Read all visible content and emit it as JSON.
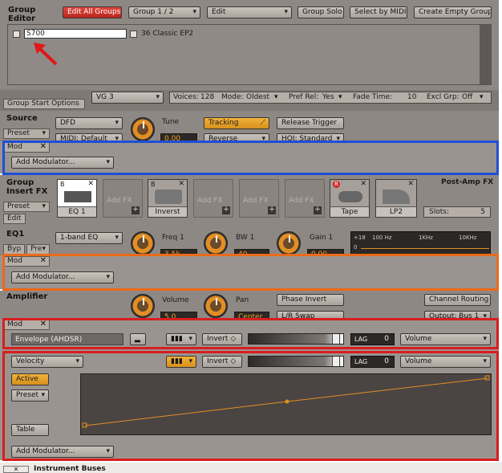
{
  "group_editor": {
    "title_line1": "Group",
    "title_line2": "Editor",
    "buttons": {
      "edit_all_groups": "Edit All Groups",
      "group_select": "Group 1 / 2",
      "edit": "Edit",
      "group_solo": "Group Solo",
      "select_by_midi": "Select by MIDI",
      "create_empty_group": "Create Empty Group"
    },
    "groups": [
      {
        "name": "S700",
        "checked": false
      },
      {
        "name": "36 Classic EP2",
        "checked": false
      }
    ]
  },
  "group_start_options": {
    "tab_label": "Group Start Options",
    "vg_value": "VG 3",
    "voices_label": "Voices:",
    "voices_value": "128",
    "mode_label": "Mode:",
    "mode_value": "Oldest",
    "pref_rel_label": "Pref Rel:",
    "pref_rel_value": "Yes",
    "fade_time_label": "Fade Time:",
    "fade_time_value": "10",
    "excl_grp_label": "Excl Grp:",
    "excl_grp_value": "Off"
  },
  "source": {
    "title": "Source",
    "preset_label": "Preset",
    "mode_value": "DFD",
    "midi_default": "MIDI: Default",
    "tune_label": "Tune",
    "tune_value": "0.00",
    "tracking_label": "Tracking",
    "reverse_label": "Reverse",
    "release_trigger_label": "Release Trigger",
    "hq_label": "HQI: Standard"
  },
  "mod_source": {
    "tab_label": "Mod",
    "add_modulator": "Add Modulator..."
  },
  "insert_fx": {
    "title_line1": "Group",
    "title_line2": "Insert FX",
    "preset_label": "Preset",
    "edit_label": "Edit",
    "post_amp_label": "Post-Amp FX",
    "slots_label": "Slots:",
    "slots_value": "5",
    "slots": [
      {
        "name": "EQ 1",
        "state": "filled"
      },
      {
        "name": "Add FX",
        "state": "empty"
      },
      {
        "name": "Inverst",
        "state": "filled"
      },
      {
        "name": "Add FX",
        "state": "empty"
      },
      {
        "name": "Add FX",
        "state": "empty"
      },
      {
        "name": "Add FX",
        "state": "empty"
      }
    ],
    "post_slots": [
      {
        "name": "Tape",
        "state": "filled"
      },
      {
        "name": "LP2",
        "state": "filled"
      }
    ]
  },
  "eq1": {
    "title": "EQ1",
    "byp_label": "Byp",
    "pre_label": "Pre",
    "type_value": "1-band EQ",
    "freq_label": "Freq 1",
    "freq_value": "3.5k",
    "bw_label": "BW 1",
    "bw_value": "40",
    "gain_label": "Gain 1",
    "gain_value": "0.00",
    "db_ticks": [
      "+18",
      "0"
    ],
    "freq_ticks": [
      "100 Hz",
      "1KHz",
      "10KHz"
    ]
  },
  "mod_eq": {
    "tab_label": "Mod",
    "add_modulator": "Add Modulator..."
  },
  "amplifier": {
    "title": "Amplifier",
    "volume_label": "Volume",
    "volume_value": "5.0",
    "pan_label": "Pan",
    "pan_value": "Center",
    "phase_invert_label": "Phase Invert",
    "lr_swap_label": "L/R Swap",
    "channel_routing_label": "Channel Routing",
    "output_label": "Output: Bus 1"
  },
  "mod_amp": {
    "tab_label": "Mod",
    "envelope_label": "Envelope (AHDSR)",
    "invert_label": "Invert",
    "lag_label": "LAG",
    "lag_value": "0",
    "target_value": "Volume"
  },
  "velocity_mod": {
    "source_value": "Velocity",
    "invert_label": "Invert",
    "lag_label": "LAG",
    "lag_value": "0",
    "target_value": "Volume",
    "active_label": "Active",
    "preset_label": "Preset",
    "table_label": "Table",
    "add_modulator": "Add Modulator..."
  },
  "bottom_bar": {
    "instrument_buses_label": "Instrument Buses"
  },
  "colors": {
    "panel_bg": "#8e8884",
    "accent_orange": "#e38e23",
    "highlight_blue": "#1f4fd6",
    "highlight_orange": "#ea6a1a",
    "highlight_red": "#d81e1e",
    "edit_all_groups_red": "#c8302a"
  }
}
